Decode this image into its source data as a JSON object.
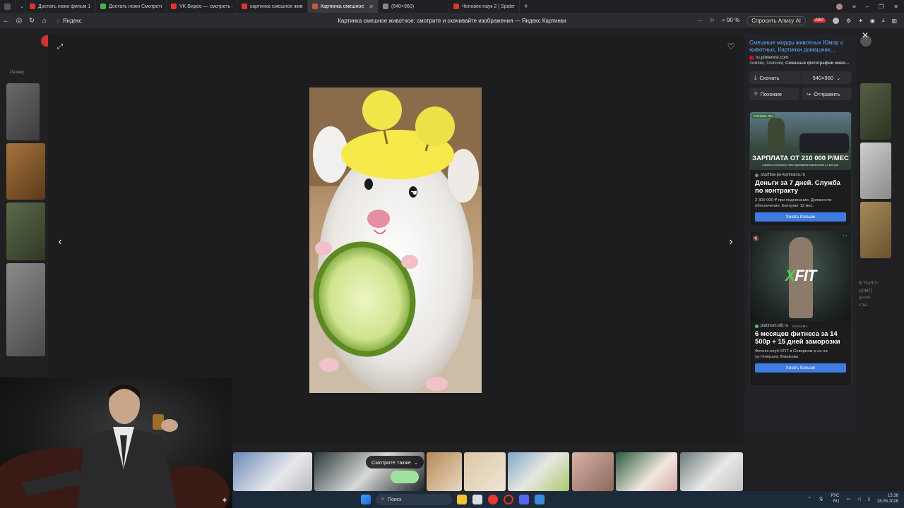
{
  "tabs": [
    {
      "label": "Достать ножи фильм 1 ч",
      "color": "#e0342f"
    },
    {
      "label": "Достать ножи Смотреть",
      "color": "#4caf50"
    },
    {
      "label": "VK Видео — смотреть он",
      "color": "#e0342f"
    },
    {
      "label": "картинка смешное живо",
      "color": "#e0342f"
    },
    {
      "label": "Картинка смешное жи",
      "color": "#c45a3a",
      "active": true
    },
    {
      "label": "(540×960)",
      "color": "#888888"
    },
    {
      "label": "Человек-паук 2 | Spider-",
      "color": "#e0342f"
    }
  ],
  "address": {
    "site": "Яндекс",
    "page_title": "Картинка смешное животное: смотрите и скачивайте изображения — Яндекс Картинки",
    "zoom": "90 %",
    "alice": "Спросить Алису AI"
  },
  "background": {
    "size_filter": "Размер",
    "right_text1": "в тыло-",
    "right_text2": "урм!)",
    "right_text3": "дескв",
    "right_text4": "ства"
  },
  "sidepanel": {
    "title": "Смешные морды животных Юмор о животных, Картинки домашних...",
    "source": "ru.pinterest.com",
    "tags_plain": "Хомяки, Хомячки,",
    "tags_bold": "Смешные фотографии живо...",
    "download": "Скачать",
    "size": "540×960",
    "similar": "Похожие",
    "share": "Отправить"
  },
  "ad1": {
    "img_headline": "ЗАРПЛАТА ОТ 210 000 Р/МЕС",
    "img_sub": "Служба по контракту. Плюс единовременная выплата 2,3 млн руб.",
    "badge": "СЛУЖБА ПО",
    "domain": "sluzhba-po-kontractu.ru",
    "headline": "Деньги за 7 дней. Служба по контракту",
    "body": "2 300 000 ₽ при подписании. Должности обеспечения. Контракт 12 мес.",
    "cta": "Узнать больше"
  },
  "ad2": {
    "logo": "XFIT",
    "domain": "platinum.xfit.ru",
    "label": "РЕКЛАМА",
    "headline": "6 месяцев фитнеса за 14 500р + 15 дней заморозки",
    "body": "Фитнес-клуб XFIT в Северном р-не на ул.Генерала Лизюкова",
    "cta": "Узнать больше"
  },
  "strip": {
    "see_also": "Смотрите также"
  },
  "taskbar": {
    "search": "Поиск",
    "lang1": "РУС",
    "lang2": "RU",
    "time": "15:36",
    "date": "28.08.2026"
  }
}
